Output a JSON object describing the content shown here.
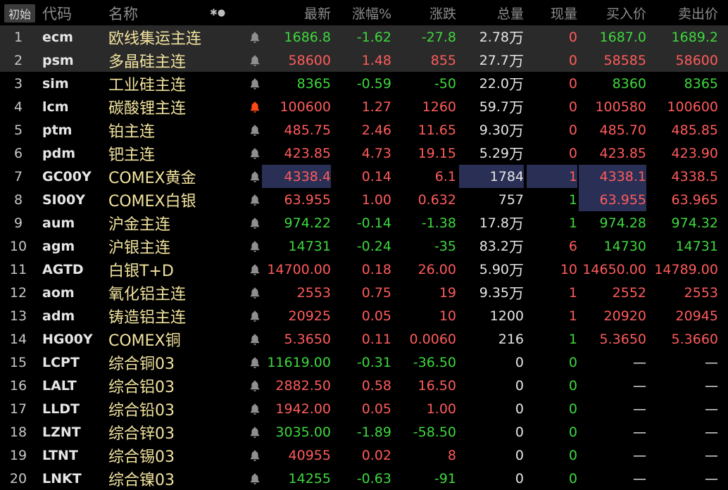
{
  "header": {
    "init_label": "初始",
    "code": "代码",
    "name": "名称",
    "icons": "✱●",
    "last": "最新",
    "pct": "涨幅%",
    "chg": "涨跌",
    "vol": "总量",
    "cur": "现量",
    "bid": "买入价",
    "ask": "卖出价"
  },
  "colors": {
    "up": "#ff5b5b",
    "down": "#3ed83e",
    "neutral": "#e6e6e6",
    "name": "#f2e39e",
    "alert": "#ff4a14"
  },
  "rows": [
    {
      "seq": "1",
      "code": "ecm",
      "name": "欧线集运主连",
      "bell": "grey",
      "last": "1686.8",
      "pct": "-1.62",
      "chg": "-27.8",
      "vol": "2.78",
      "vol_unit": "万",
      "cur": "0",
      "bid": "1687.0",
      "ask": "1689.2",
      "c_last": "green",
      "c_pct": "green",
      "c_chg": "green",
      "c_cur": "red",
      "c_bid": "green",
      "c_ask": "green",
      "bg": "gray"
    },
    {
      "seq": "2",
      "code": "psm",
      "name": "多晶硅主连",
      "bell": "grey",
      "last": "58600",
      "pct": "1.48",
      "chg": "855",
      "vol": "27.7",
      "vol_unit": "万",
      "cur": "0",
      "bid": "58585",
      "ask": "58600",
      "c_last": "red",
      "c_pct": "red",
      "c_chg": "red",
      "c_cur": "red",
      "c_bid": "red",
      "c_ask": "red",
      "bg": "gray"
    },
    {
      "seq": "3",
      "code": "sim",
      "name": "工业硅主连",
      "bell": "grey",
      "last": "8365",
      "pct": "-0.59",
      "chg": "-50",
      "vol": "22.0",
      "vol_unit": "万",
      "cur": "0",
      "bid": "8360",
      "ask": "8365",
      "c_last": "green",
      "c_pct": "green",
      "c_chg": "green",
      "c_cur": "red",
      "c_bid": "green",
      "c_ask": "green"
    },
    {
      "seq": "4",
      "code": "lcm",
      "name": "碳酸锂主连",
      "bell": "alert",
      "last": "100600",
      "pct": "1.27",
      "chg": "1260",
      "vol": "59.7",
      "vol_unit": "万",
      "cur": "0",
      "bid": "100580",
      "ask": "100600",
      "c_last": "red",
      "c_pct": "red",
      "c_chg": "red",
      "c_cur": "red",
      "c_bid": "red",
      "c_ask": "red"
    },
    {
      "seq": "5",
      "code": "ptm",
      "name": "铂主连",
      "bell": "grey",
      "last": "485.75",
      "pct": "2.46",
      "chg": "11.65",
      "vol": "9.30",
      "vol_unit": "万",
      "cur": "0",
      "bid": "485.70",
      "ask": "485.85",
      "c_last": "red",
      "c_pct": "red",
      "c_chg": "red",
      "c_cur": "red",
      "c_bid": "red",
      "c_ask": "red"
    },
    {
      "seq": "6",
      "code": "pdm",
      "name": "钯主连",
      "bell": "grey",
      "last": "423.85",
      "pct": "4.73",
      "chg": "19.15",
      "vol": "5.29",
      "vol_unit": "万",
      "cur": "0",
      "bid": "423.85",
      "ask": "423.90",
      "c_last": "red",
      "c_pct": "red",
      "c_chg": "red",
      "c_cur": "red",
      "c_bid": "red",
      "c_ask": "red"
    },
    {
      "seq": "7",
      "code": "GC00Y",
      "name": "COMEX黄金",
      "bell": "grey",
      "last": "4338.4",
      "pct": "0.14",
      "chg": "6.1",
      "vol": "1784",
      "vol_unit": "",
      "cur": "1",
      "bid": "4338.1",
      "ask": "4338.5",
      "c_last": "red",
      "c_pct": "red",
      "c_chg": "red",
      "c_cur": "red",
      "c_bid": "red",
      "c_ask": "red",
      "hl_last": true,
      "hl_vol": true
    },
    {
      "seq": "8",
      "code": "SI00Y",
      "name": "COMEX白银",
      "bell": "grey",
      "last": "63.955",
      "pct": "1.00",
      "chg": "0.632",
      "vol": "757",
      "vol_unit": "",
      "cur": "1",
      "bid": "63.955",
      "ask": "63.965",
      "c_last": "red",
      "c_pct": "red",
      "c_chg": "red",
      "c_cur": "green",
      "c_bid": "red",
      "c_ask": "red",
      "hl_bid": true
    },
    {
      "seq": "9",
      "code": "aum",
      "name": "沪金主连",
      "bell": "grey",
      "last": "974.22",
      "pct": "-0.14",
      "chg": "-1.38",
      "vol": "17.8",
      "vol_unit": "万",
      "cur": "1",
      "bid": "974.28",
      "ask": "974.32",
      "c_last": "green",
      "c_pct": "green",
      "c_chg": "green",
      "c_cur": "green",
      "c_bid": "green",
      "c_ask": "green"
    },
    {
      "seq": "10",
      "code": "agm",
      "name": "沪银主连",
      "bell": "grey",
      "last": "14731",
      "pct": "-0.24",
      "chg": "-35",
      "vol": "83.2",
      "vol_unit": "万",
      "cur": "6",
      "bid": "14730",
      "ask": "14731",
      "c_last": "green",
      "c_pct": "green",
      "c_chg": "green",
      "c_cur": "red",
      "c_bid": "green",
      "c_ask": "green"
    },
    {
      "seq": "11",
      "code": "AGTD",
      "name": "白银T+D",
      "bell": "grey",
      "last": "14700.00",
      "pct": "0.18",
      "chg": "26.00",
      "vol": "5.90",
      "vol_unit": "万",
      "cur": "10",
      "bid": "14650.00",
      "ask": "14789.00",
      "c_last": "red",
      "c_pct": "red",
      "c_chg": "red",
      "c_cur": "red",
      "c_bid": "red",
      "c_ask": "red"
    },
    {
      "seq": "12",
      "code": "aom",
      "name": "氧化铝主连",
      "bell": "grey",
      "last": "2553",
      "pct": "0.75",
      "chg": "19",
      "vol": "9.35",
      "vol_unit": "万",
      "cur": "1",
      "bid": "2552",
      "ask": "2553",
      "c_last": "red",
      "c_pct": "red",
      "c_chg": "red",
      "c_cur": "red",
      "c_bid": "red",
      "c_ask": "red"
    },
    {
      "seq": "13",
      "code": "adm",
      "name": "铸造铝主连",
      "bell": "grey",
      "last": "20925",
      "pct": "0.05",
      "chg": "10",
      "vol": "1200",
      "vol_unit": "",
      "cur": "1",
      "bid": "20920",
      "ask": "20945",
      "c_last": "red",
      "c_pct": "red",
      "c_chg": "red",
      "c_cur": "red",
      "c_bid": "red",
      "c_ask": "red"
    },
    {
      "seq": "14",
      "code": "HG00Y",
      "name": "COMEX铜",
      "bell": "grey",
      "last": "5.3650",
      "pct": "0.11",
      "chg": "0.0060",
      "vol": "216",
      "vol_unit": "",
      "cur": "1",
      "bid": "5.3650",
      "ask": "5.3660",
      "c_last": "red",
      "c_pct": "red",
      "c_chg": "red",
      "c_cur": "green",
      "c_bid": "red",
      "c_ask": "red"
    },
    {
      "seq": "15",
      "code": "LCPT",
      "name": "综合铜03",
      "bell": "grey",
      "last": "11619.00",
      "pct": "-0.31",
      "chg": "-36.50",
      "vol": "0",
      "vol_unit": "",
      "cur": "0",
      "bid": "—",
      "ask": "—",
      "c_last": "green",
      "c_pct": "green",
      "c_chg": "green",
      "c_cur": "green",
      "c_bid": "white",
      "c_ask": "white"
    },
    {
      "seq": "16",
      "code": "LALT",
      "name": "综合铝03",
      "bell": "grey",
      "last": "2882.50",
      "pct": "0.58",
      "chg": "16.50",
      "vol": "0",
      "vol_unit": "",
      "cur": "0",
      "bid": "—",
      "ask": "—",
      "c_last": "red",
      "c_pct": "red",
      "c_chg": "red",
      "c_cur": "green",
      "c_bid": "white",
      "c_ask": "white"
    },
    {
      "seq": "17",
      "code": "LLDT",
      "name": "综合铅03",
      "bell": "grey",
      "last": "1942.00",
      "pct": "0.05",
      "chg": "1.00",
      "vol": "0",
      "vol_unit": "",
      "cur": "0",
      "bid": "—",
      "ask": "—",
      "c_last": "red",
      "c_pct": "red",
      "c_chg": "red",
      "c_cur": "green",
      "c_bid": "white",
      "c_ask": "white"
    },
    {
      "seq": "18",
      "code": "LZNT",
      "name": "综合锌03",
      "bell": "grey",
      "last": "3035.00",
      "pct": "-1.89",
      "chg": "-58.50",
      "vol": "0",
      "vol_unit": "",
      "cur": "0",
      "bid": "—",
      "ask": "—",
      "c_last": "green",
      "c_pct": "green",
      "c_chg": "green",
      "c_cur": "green",
      "c_bid": "white",
      "c_ask": "white"
    },
    {
      "seq": "19",
      "code": "LTNT",
      "name": "综合锡03",
      "bell": "grey",
      "last": "40955",
      "pct": "0.02",
      "chg": "8",
      "vol": "0",
      "vol_unit": "",
      "cur": "0",
      "bid": "—",
      "ask": "—",
      "c_last": "red",
      "c_pct": "red",
      "c_chg": "red",
      "c_cur": "green",
      "c_bid": "white",
      "c_ask": "white"
    },
    {
      "seq": "20",
      "code": "LNKT",
      "name": "综合镍03",
      "bell": "grey",
      "last": "14255",
      "pct": "-0.63",
      "chg": "-91",
      "vol": "0",
      "vol_unit": "",
      "cur": "0",
      "bid": "—",
      "ask": "—",
      "c_last": "green",
      "c_pct": "green",
      "c_chg": "green",
      "c_cur": "green",
      "c_bid": "white",
      "c_ask": "white"
    }
  ]
}
